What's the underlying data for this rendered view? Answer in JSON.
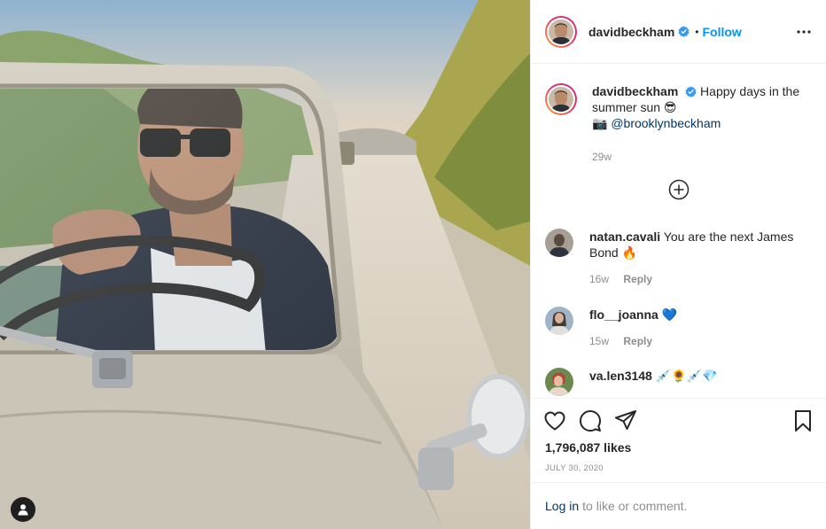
{
  "post": {
    "username": "davidbeckham",
    "follow_label": "Follow",
    "separator": "•"
  },
  "caption": {
    "username": "davidbeckham",
    "text": "Happy days in the summer sun 😎",
    "camera_emoji": "📷",
    "mention": "@brooklynbeckham",
    "time": "29w"
  },
  "comments": [
    {
      "username": "natan.cavali",
      "text": "You are the next James Bond 🔥",
      "time": "16w",
      "reply_label": "Reply"
    },
    {
      "username": "flo__joanna",
      "text": "💙",
      "time": "15w",
      "reply_label": "Reply"
    },
    {
      "username": "va.len3148",
      "text": "💉🌻💉💎",
      "time": "",
      "reply_label": ""
    }
  ],
  "engagement": {
    "likes": "1,796,087 likes",
    "date": "JULY 30, 2020"
  },
  "login_prompt": {
    "link": "Log in",
    "rest": "to like or comment."
  },
  "icons": {
    "verified": "verified-badge-icon",
    "more": "more-options-icon",
    "load_more": "plus-circle-icon",
    "like": "heart-icon",
    "comment": "comment-bubble-icon",
    "share": "paper-plane-icon",
    "save": "bookmark-icon",
    "tags": "person-icon"
  },
  "colors": {
    "link_blue": "#0095f6",
    "mention_blue": "#00376b",
    "muted_gray": "#8e8e8e",
    "text_dark": "#262626",
    "verified_blue": "#3897f0"
  }
}
